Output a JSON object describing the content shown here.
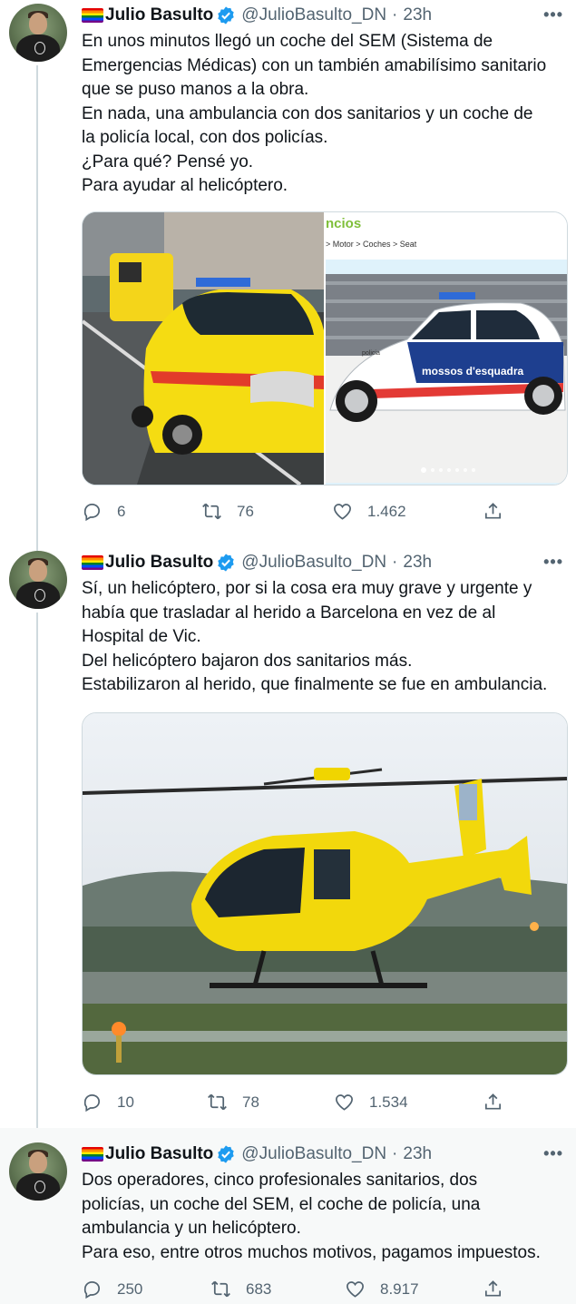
{
  "tweets": [
    {
      "author_name": "Julio Basulto",
      "handle": "@JulioBasulto_DN",
      "time": "23h",
      "lines": [
        "En unos minutos llegó un coche del SEM (Sistema de",
        "Emergencias Médicas) con un también amabilísimo sanitario",
        "que se puso manos a la obra.",
        "En nada, una ambulancia con dos sanitarios y un coche de",
        "la policía local, con dos policías.",
        "¿Para qué? Pensé yo.",
        "Para ayudar al helicóptero."
      ],
      "media_caption_text": "ncios",
      "media_breadcrumb": "> Motor > Coches > Seat",
      "police_car_text": "mossos d'esquadra",
      "police_label": "policia",
      "replies": "6",
      "retweets": "76",
      "likes": "1.462"
    },
    {
      "author_name": "Julio Basulto",
      "handle": "@JulioBasulto_DN",
      "time": "23h",
      "lines": [
        "Sí, un helicóptero, por si la cosa era muy grave y urgente y",
        "había que trasladar al herido a Barcelona en vez de al",
        "Hospital de Vic.",
        "Del helicóptero bajaron dos sanitarios más.",
        "Estabilizaron al herido, que finalmente se fue en ambulancia."
      ],
      "replies": "10",
      "retweets": "78",
      "likes": "1.534"
    },
    {
      "author_name": "Julio Basulto",
      "handle": "@JulioBasulto_DN",
      "time": "23h",
      "lines": [
        "Dos operadores, cinco profesionales sanitarios, dos",
        "policías, un coche del SEM, el coche de policía, una",
        "ambulancia y un helicóptero.",
        "Para eso, entre otros muchos motivos, pagamos impuestos."
      ],
      "replies": "250",
      "retweets": "683",
      "likes": "8.917"
    }
  ],
  "colors": {
    "text": "#0f1419",
    "secondary": "#536471",
    "verified": "#1d9bf0",
    "thread_line": "#cfd9de",
    "highlight_bg": "#f7f9f9"
  },
  "icons": [
    "more-icon",
    "verified-badge-icon",
    "reply-icon",
    "retweet-icon",
    "like-icon",
    "share-icon"
  ]
}
